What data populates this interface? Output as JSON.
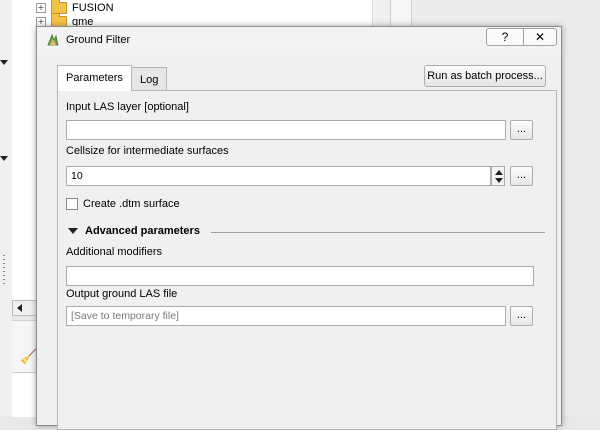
{
  "background": {
    "tree_items": [
      {
        "expand": "+",
        "label": "FUSION"
      },
      {
        "expand": "+",
        "label": "gme"
      }
    ]
  },
  "dialog": {
    "title": "Ground Filter",
    "help_label": "?",
    "close_label": "✕",
    "tabs": [
      {
        "label": "Parameters",
        "active": true
      },
      {
        "label": "Log",
        "active": false
      }
    ],
    "batch_button": "Run as batch process...",
    "params": {
      "input_label": "Input LAS layer [optional]",
      "input_value": "",
      "browse_label": "...",
      "cellsize_label": "Cellsize for intermediate surfaces",
      "cellsize_value": "10",
      "checkbox_label": "Create .dtm surface",
      "checkbox_checked": false,
      "advanced_label": "Advanced parameters",
      "modifiers_label": "Additional modifiers",
      "modifiers_value": "",
      "output_label": "Output ground LAS file",
      "output_placeholder": "[Save to temporary file]"
    }
  },
  "colors": {
    "dialog_bg": "#f0f0f0",
    "field_border": "#ababab",
    "folder": "#f3c34a"
  }
}
